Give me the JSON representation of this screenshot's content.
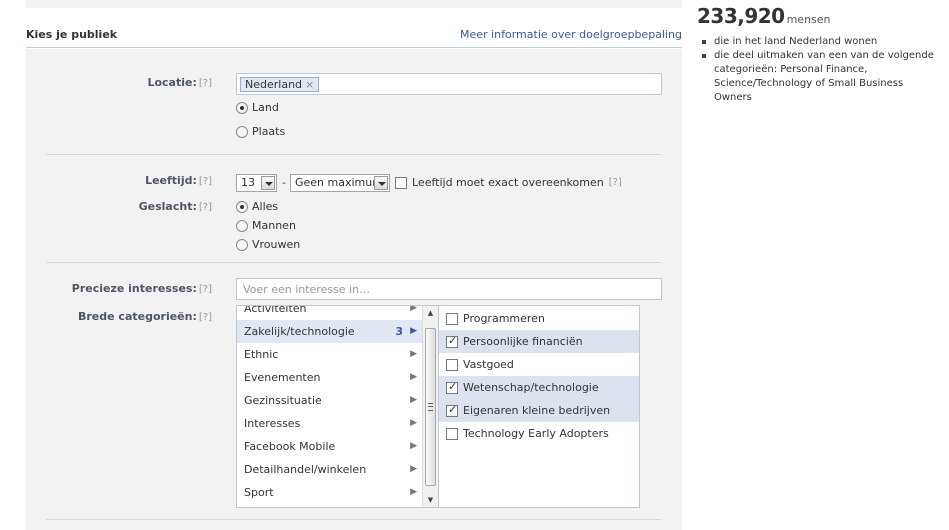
{
  "audience": {
    "header_title": "Kies je publiek",
    "info_link": "Meer informatie over doelgroepbepaling",
    "location": {
      "label": "Locatie:",
      "help": "[?]",
      "token": "Nederland",
      "token_remove": "×",
      "options": [
        {
          "label": "Land",
          "selected": true
        },
        {
          "label": "Plaats",
          "selected": false
        }
      ]
    },
    "age": {
      "label": "Leeftijd:",
      "help": "[?]",
      "min": "13",
      "dash": "-",
      "max": "Geen maximum",
      "exact_label": "Leeftijd moet exact overeenkomen",
      "exact_help": "[?]",
      "exact_checked": false
    },
    "gender": {
      "label": "Geslacht:",
      "help": "[?]",
      "options": [
        {
          "label": "Alles",
          "selected": true
        },
        {
          "label": "Mannen",
          "selected": false
        },
        {
          "label": "Vrouwen",
          "selected": false
        }
      ]
    },
    "interests": {
      "label": "Precieze interesses:",
      "help": "[?]",
      "placeholder": "Voer een interesse in…"
    },
    "broad": {
      "label": "Brede categorieën:",
      "help": "[?]",
      "categories": [
        {
          "label": "Activiteiten",
          "count": ""
        },
        {
          "label": "Zakelijk/technologie",
          "count": "3"
        },
        {
          "label": "Ethnic",
          "count": ""
        },
        {
          "label": "Evenementen",
          "count": ""
        },
        {
          "label": "Gezinssituatie",
          "count": ""
        },
        {
          "label": "Interesses",
          "count": ""
        },
        {
          "label": "Facebook Mobile",
          "count": ""
        },
        {
          "label": "Detailhandel/winkelen",
          "count": ""
        },
        {
          "label": "Sport",
          "count": ""
        }
      ],
      "active_category": "Zakelijk/technologie",
      "subcategories": [
        {
          "label": "Programmeren",
          "checked": false
        },
        {
          "label": "Persoonlijke financiën",
          "checked": true
        },
        {
          "label": "Vastgoed",
          "checked": false
        },
        {
          "label": "Wetenschap/technologie",
          "checked": true
        },
        {
          "label": "Eigenaren kleine bedrijven",
          "checked": true
        },
        {
          "label": "Technology Early Adopters",
          "checked": false
        }
      ]
    }
  },
  "estimate": {
    "count": "233,920",
    "unit": "mensen",
    "bullets": [
      "die in het land Nederland wonen",
      "die deel uitmaken van een van de volgende categorieën: Personal Finance, Science/Technology of Small Business Owners"
    ]
  }
}
